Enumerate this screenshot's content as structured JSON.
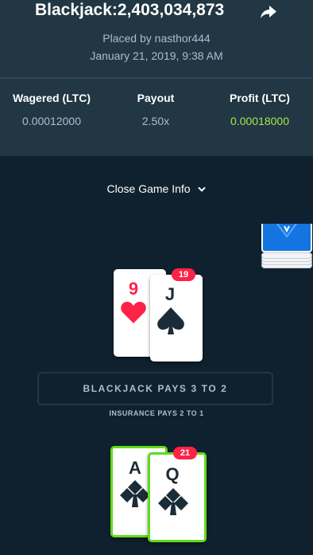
{
  "header": {
    "title": "Blackjack:2,403,034,873",
    "placed_by": "Placed by nasthor444",
    "date": "January 21, 2019, 9:38 AM",
    "share_icon": "share-arrow-icon"
  },
  "stats": {
    "wagered_label": "Wagered (LTC)",
    "wagered_value": "0.00012000",
    "payout_label": "Payout",
    "payout_value": "2.50x",
    "profit_label": "Profit (LTC)",
    "profit_value": "0.00018000"
  },
  "toggle": {
    "label": "Close Game Info",
    "icon": "chevron-down-icon"
  },
  "dealer": {
    "total": "19",
    "cards": [
      {
        "rank": "9",
        "suit": "hearts"
      },
      {
        "rank": "J",
        "suit": "spades"
      }
    ]
  },
  "table": {
    "banner": "BLACKJACK PAYS 3 TO 2",
    "insurance": "INSURANCE PAYS 2 TO 1"
  },
  "player": {
    "total": "21",
    "cards": [
      {
        "rank": "A",
        "suit": "clubs"
      },
      {
        "rank": "Q",
        "suit": "clubs"
      }
    ]
  },
  "colors": {
    "background": "#0f212e",
    "header": "#213743",
    "profit_green": "#a2e84e",
    "win_border": "#5fdc1c",
    "badge_red": "#fe2247",
    "card_back_blue": "#1475e1"
  }
}
